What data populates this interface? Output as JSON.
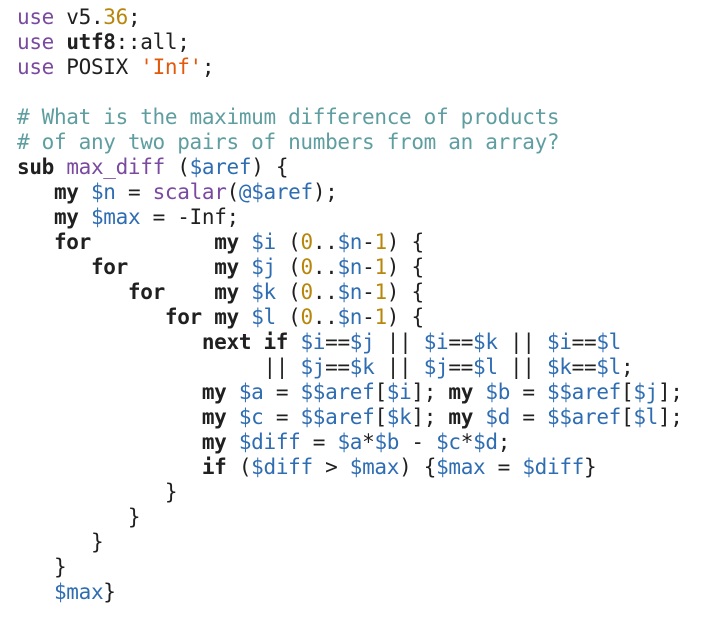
{
  "colors": {
    "background": "#ffffff",
    "text": "#202020",
    "keyword": "#7a4aa0",
    "bold_keyword": "#202020",
    "number": "#b8860b",
    "string": "#e3590c",
    "comment": "#5f9ea0",
    "variable": "#2f6db3"
  },
  "code": {
    "lines": [
      [
        {
          "t": "kw",
          "s": "use"
        },
        {
          "t": "txt",
          "s": " v5."
        },
        {
          "t": "num",
          "s": "36"
        },
        {
          "t": "txt",
          "s": ";"
        }
      ],
      [
        {
          "t": "kw",
          "s": "use"
        },
        {
          "t": "txt",
          "s": " "
        },
        {
          "t": "mod",
          "s": "utf8"
        },
        {
          "t": "txt",
          "s": "::all;"
        }
      ],
      [
        {
          "t": "kw",
          "s": "use"
        },
        {
          "t": "txt",
          "s": " POSIX "
        },
        {
          "t": "str",
          "s": "'Inf'"
        },
        {
          "t": "txt",
          "s": ";"
        }
      ],
      [],
      [
        {
          "t": "cmt",
          "s": "# What is the maximum difference of products"
        }
      ],
      [
        {
          "t": "cmt",
          "s": "# of any two pairs of numbers from an array?"
        }
      ],
      [
        {
          "t": "kwb",
          "s": "sub"
        },
        {
          "t": "txt",
          "s": " "
        },
        {
          "t": "fn",
          "s": "max_diff"
        },
        {
          "t": "txt",
          "s": " ("
        },
        {
          "t": "var",
          "s": "$aref"
        },
        {
          "t": "txt",
          "s": ") {"
        }
      ],
      [
        {
          "t": "txt",
          "s": "   "
        },
        {
          "t": "kwb",
          "s": "my"
        },
        {
          "t": "txt",
          "s": " "
        },
        {
          "t": "var",
          "s": "$n"
        },
        {
          "t": "txt",
          "s": " = "
        },
        {
          "t": "fn",
          "s": "scalar"
        },
        {
          "t": "txt",
          "s": "("
        },
        {
          "t": "var",
          "s": "@$aref"
        },
        {
          "t": "txt",
          "s": ");"
        }
      ],
      [
        {
          "t": "txt",
          "s": "   "
        },
        {
          "t": "kwb",
          "s": "my"
        },
        {
          "t": "txt",
          "s": " "
        },
        {
          "t": "var",
          "s": "$max"
        },
        {
          "t": "txt",
          "s": " = -Inf;"
        }
      ],
      [
        {
          "t": "txt",
          "s": "   "
        },
        {
          "t": "kwb",
          "s": "for"
        },
        {
          "t": "txt",
          "s": "          "
        },
        {
          "t": "kwb",
          "s": "my"
        },
        {
          "t": "txt",
          "s": " "
        },
        {
          "t": "var",
          "s": "$i"
        },
        {
          "t": "txt",
          "s": " ("
        },
        {
          "t": "num",
          "s": "0"
        },
        {
          "t": "txt",
          "s": ".."
        },
        {
          "t": "var",
          "s": "$n"
        },
        {
          "t": "txt",
          "s": "-"
        },
        {
          "t": "num",
          "s": "1"
        },
        {
          "t": "txt",
          "s": ") {"
        }
      ],
      [
        {
          "t": "txt",
          "s": "      "
        },
        {
          "t": "kwb",
          "s": "for"
        },
        {
          "t": "txt",
          "s": "       "
        },
        {
          "t": "kwb",
          "s": "my"
        },
        {
          "t": "txt",
          "s": " "
        },
        {
          "t": "var",
          "s": "$j"
        },
        {
          "t": "txt",
          "s": " ("
        },
        {
          "t": "num",
          "s": "0"
        },
        {
          "t": "txt",
          "s": ".."
        },
        {
          "t": "var",
          "s": "$n"
        },
        {
          "t": "txt",
          "s": "-"
        },
        {
          "t": "num",
          "s": "1"
        },
        {
          "t": "txt",
          "s": ") {"
        }
      ],
      [
        {
          "t": "txt",
          "s": "         "
        },
        {
          "t": "kwb",
          "s": "for"
        },
        {
          "t": "txt",
          "s": "    "
        },
        {
          "t": "kwb",
          "s": "my"
        },
        {
          "t": "txt",
          "s": " "
        },
        {
          "t": "var",
          "s": "$k"
        },
        {
          "t": "txt",
          "s": " ("
        },
        {
          "t": "num",
          "s": "0"
        },
        {
          "t": "txt",
          "s": ".."
        },
        {
          "t": "var",
          "s": "$n"
        },
        {
          "t": "txt",
          "s": "-"
        },
        {
          "t": "num",
          "s": "1"
        },
        {
          "t": "txt",
          "s": ") {"
        }
      ],
      [
        {
          "t": "txt",
          "s": "            "
        },
        {
          "t": "kwb",
          "s": "for"
        },
        {
          "t": "txt",
          "s": " "
        },
        {
          "t": "kwb",
          "s": "my"
        },
        {
          "t": "txt",
          "s": " "
        },
        {
          "t": "var",
          "s": "$l"
        },
        {
          "t": "txt",
          "s": " ("
        },
        {
          "t": "num",
          "s": "0"
        },
        {
          "t": "txt",
          "s": ".."
        },
        {
          "t": "var",
          "s": "$n"
        },
        {
          "t": "txt",
          "s": "-"
        },
        {
          "t": "num",
          "s": "1"
        },
        {
          "t": "txt",
          "s": ") {"
        }
      ],
      [
        {
          "t": "txt",
          "s": "               "
        },
        {
          "t": "kwb",
          "s": "next"
        },
        {
          "t": "txt",
          "s": " "
        },
        {
          "t": "kwb",
          "s": "if"
        },
        {
          "t": "txt",
          "s": " "
        },
        {
          "t": "var",
          "s": "$i"
        },
        {
          "t": "txt",
          "s": "=="
        },
        {
          "t": "var",
          "s": "$j"
        },
        {
          "t": "txt",
          "s": " || "
        },
        {
          "t": "var",
          "s": "$i"
        },
        {
          "t": "txt",
          "s": "=="
        },
        {
          "t": "var",
          "s": "$k"
        },
        {
          "t": "txt",
          "s": " || "
        },
        {
          "t": "var",
          "s": "$i"
        },
        {
          "t": "txt",
          "s": "=="
        },
        {
          "t": "var",
          "s": "$l"
        }
      ],
      [
        {
          "t": "txt",
          "s": "                    || "
        },
        {
          "t": "var",
          "s": "$j"
        },
        {
          "t": "txt",
          "s": "=="
        },
        {
          "t": "var",
          "s": "$k"
        },
        {
          "t": "txt",
          "s": " || "
        },
        {
          "t": "var",
          "s": "$j"
        },
        {
          "t": "txt",
          "s": "=="
        },
        {
          "t": "var",
          "s": "$l"
        },
        {
          "t": "txt",
          "s": " || "
        },
        {
          "t": "var",
          "s": "$k"
        },
        {
          "t": "txt",
          "s": "=="
        },
        {
          "t": "var",
          "s": "$l"
        },
        {
          "t": "txt",
          "s": ";"
        }
      ],
      [
        {
          "t": "txt",
          "s": "               "
        },
        {
          "t": "kwb",
          "s": "my"
        },
        {
          "t": "txt",
          "s": " "
        },
        {
          "t": "var",
          "s": "$a"
        },
        {
          "t": "txt",
          "s": " = "
        },
        {
          "t": "var",
          "s": "$$aref"
        },
        {
          "t": "txt",
          "s": "["
        },
        {
          "t": "var",
          "s": "$i"
        },
        {
          "t": "txt",
          "s": "]; "
        },
        {
          "t": "kwb",
          "s": "my"
        },
        {
          "t": "txt",
          "s": " "
        },
        {
          "t": "var",
          "s": "$b"
        },
        {
          "t": "txt",
          "s": " = "
        },
        {
          "t": "var",
          "s": "$$aref"
        },
        {
          "t": "txt",
          "s": "["
        },
        {
          "t": "var",
          "s": "$j"
        },
        {
          "t": "txt",
          "s": "];"
        }
      ],
      [
        {
          "t": "txt",
          "s": "               "
        },
        {
          "t": "kwb",
          "s": "my"
        },
        {
          "t": "txt",
          "s": " "
        },
        {
          "t": "var",
          "s": "$c"
        },
        {
          "t": "txt",
          "s": " = "
        },
        {
          "t": "var",
          "s": "$$aref"
        },
        {
          "t": "txt",
          "s": "["
        },
        {
          "t": "var",
          "s": "$k"
        },
        {
          "t": "txt",
          "s": "]; "
        },
        {
          "t": "kwb",
          "s": "my"
        },
        {
          "t": "txt",
          "s": " "
        },
        {
          "t": "var",
          "s": "$d"
        },
        {
          "t": "txt",
          "s": " = "
        },
        {
          "t": "var",
          "s": "$$aref"
        },
        {
          "t": "txt",
          "s": "["
        },
        {
          "t": "var",
          "s": "$l"
        },
        {
          "t": "txt",
          "s": "];"
        }
      ],
      [
        {
          "t": "txt",
          "s": "               "
        },
        {
          "t": "kwb",
          "s": "my"
        },
        {
          "t": "txt",
          "s": " "
        },
        {
          "t": "var",
          "s": "$diff"
        },
        {
          "t": "txt",
          "s": " = "
        },
        {
          "t": "var",
          "s": "$a"
        },
        {
          "t": "txt",
          "s": "*"
        },
        {
          "t": "var",
          "s": "$b"
        },
        {
          "t": "txt",
          "s": " - "
        },
        {
          "t": "var",
          "s": "$c"
        },
        {
          "t": "txt",
          "s": "*"
        },
        {
          "t": "var",
          "s": "$d"
        },
        {
          "t": "txt",
          "s": ";"
        }
      ],
      [
        {
          "t": "txt",
          "s": "               "
        },
        {
          "t": "kwb",
          "s": "if"
        },
        {
          "t": "txt",
          "s": " ("
        },
        {
          "t": "var",
          "s": "$diff"
        },
        {
          "t": "txt",
          "s": " > "
        },
        {
          "t": "var",
          "s": "$max"
        },
        {
          "t": "txt",
          "s": ") {"
        },
        {
          "t": "var",
          "s": "$max"
        },
        {
          "t": "txt",
          "s": " = "
        },
        {
          "t": "var",
          "s": "$diff"
        },
        {
          "t": "txt",
          "s": "}"
        }
      ],
      [
        {
          "t": "txt",
          "s": "            }"
        }
      ],
      [
        {
          "t": "txt",
          "s": "         }"
        }
      ],
      [
        {
          "t": "txt",
          "s": "      }"
        }
      ],
      [
        {
          "t": "txt",
          "s": "   }"
        }
      ],
      [
        {
          "t": "txt",
          "s": "   "
        },
        {
          "t": "var",
          "s": "$max"
        },
        {
          "t": "txt",
          "s": "}"
        }
      ]
    ]
  }
}
